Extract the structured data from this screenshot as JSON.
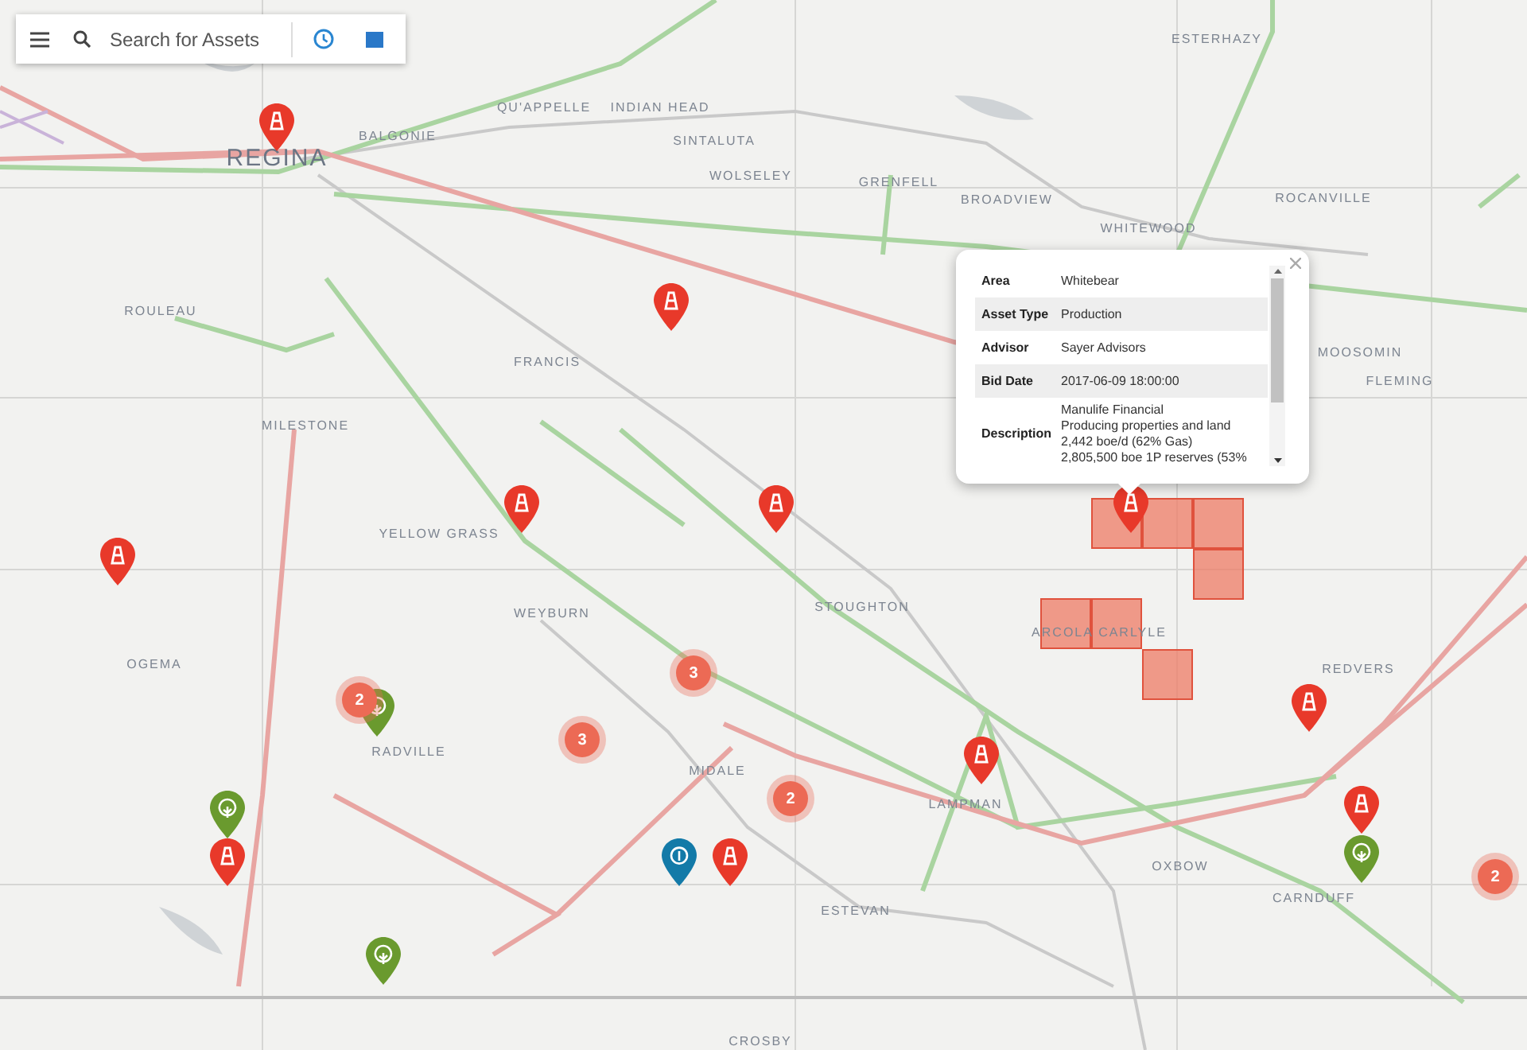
{
  "search": {
    "placeholder": "Search for Assets"
  },
  "places": [
    {
      "name": "REGINA",
      "kind": "city"
    },
    {
      "name": "BALGONIE",
      "kind": "town"
    },
    {
      "name": "QU'APPELLE",
      "kind": "town"
    },
    {
      "name": "INDIAN HEAD",
      "kind": "town"
    },
    {
      "name": "SINTALUTA",
      "kind": "town"
    },
    {
      "name": "WOLSELEY",
      "kind": "town"
    },
    {
      "name": "GRENFELL",
      "kind": "town"
    },
    {
      "name": "BROADVIEW",
      "kind": "town"
    },
    {
      "name": "WHITEWOOD",
      "kind": "town"
    },
    {
      "name": "ESTERHAZY",
      "kind": "town"
    },
    {
      "name": "ROCANVILLE",
      "kind": "town"
    },
    {
      "name": "MOOSOMIN",
      "kind": "town"
    },
    {
      "name": "FLEMING",
      "kind": "town"
    },
    {
      "name": "ROULEAU",
      "kind": "town"
    },
    {
      "name": "FRANCIS",
      "kind": "town"
    },
    {
      "name": "MILESTONE",
      "kind": "town"
    },
    {
      "name": "YELLOW GRASS",
      "kind": "town"
    },
    {
      "name": "WEYBURN",
      "kind": "town"
    },
    {
      "name": "OGEMA",
      "kind": "town"
    },
    {
      "name": "STOUGHTON",
      "kind": "town"
    },
    {
      "name": "ARCOLA",
      "kind": "town"
    },
    {
      "name": "CARLYLE",
      "kind": "town"
    },
    {
      "name": "REDVERS",
      "kind": "town"
    },
    {
      "name": "RADVILLE",
      "kind": "town"
    },
    {
      "name": "MIDALE",
      "kind": "town"
    },
    {
      "name": "LAMPMAN",
      "kind": "town"
    },
    {
      "name": "ESTEVAN",
      "kind": "town"
    },
    {
      "name": "OXBOW",
      "kind": "town"
    },
    {
      "name": "CARNDUFF",
      "kind": "town"
    },
    {
      "name": "CROSBY",
      "kind": "town"
    }
  ],
  "markers": [
    {
      "kind": "oil"
    },
    {
      "kind": "oil"
    },
    {
      "kind": "oil"
    },
    {
      "kind": "oil"
    },
    {
      "kind": "oil"
    },
    {
      "kind": "oil"
    },
    {
      "kind": "oil"
    },
    {
      "kind": "oil"
    },
    {
      "kind": "oil"
    },
    {
      "kind": "oil"
    },
    {
      "kind": "oil"
    },
    {
      "kind": "green"
    },
    {
      "kind": "green"
    },
    {
      "kind": "green"
    },
    {
      "kind": "green"
    },
    {
      "kind": "blue"
    },
    {
      "kind": "cluster",
      "count": "2"
    },
    {
      "kind": "cluster",
      "count": "3"
    },
    {
      "kind": "cluster",
      "count": "3"
    },
    {
      "kind": "cluster",
      "count": "2"
    },
    {
      "kind": "cluster",
      "count": "2"
    }
  ],
  "popup": {
    "rows": [
      {
        "label": "Area",
        "value": "Whitebear"
      },
      {
        "label": "Asset Type",
        "value": "Production"
      },
      {
        "label": "Advisor",
        "value": "Sayer Advisors"
      },
      {
        "label": "Bid Date",
        "value": "2017-06-09 18:00:00"
      },
      {
        "label": "Description",
        "lines": [
          "Manulife Financial",
          "Producing properties and land",
          "2,442 boe/d (62% Gas)",
          "2,805,500 boe 1P reserves (53%"
        ]
      }
    ]
  }
}
